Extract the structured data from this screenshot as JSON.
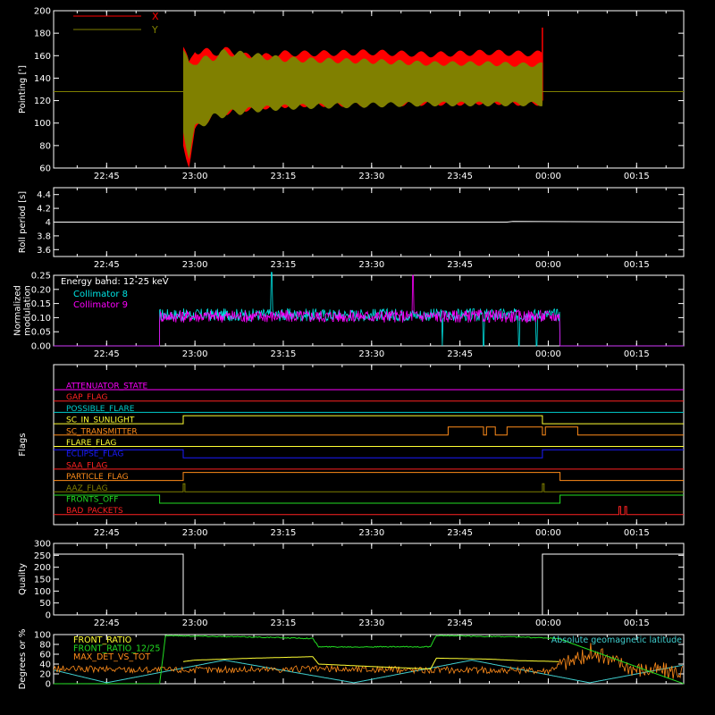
{
  "colors": {
    "background": "#000000",
    "axis": "#ffffff",
    "x_series": "#ff0000",
    "y_series": "#808000",
    "collimator8": "#00e5e5",
    "collimator9": "#ff00ff",
    "attenuator_state": "#ff00ff",
    "gap_flag": "#ff2222",
    "possible_flare": "#00cccc",
    "sc_in_sunlight": "#ffff33",
    "sc_transmitter": "#ff8c1a",
    "flare_flag": "#ffff33",
    "eclipse_flag": "#1b1bff",
    "saa_flag": "#ff2222",
    "particle_flag": "#ff8c1a",
    "aaz_flag": "#808000",
    "fronts_off": "#22dd22",
    "bad_packets": "#ff2222",
    "quality": "#ffffff",
    "front_ratio": "#ffff33",
    "front_ratio_1225": "#22dd22",
    "max_det_vs_tot": "#ff8c1a",
    "latitude": "#40d0d0"
  },
  "chart_data": [
    {
      "id": "pointing",
      "type": "line",
      "ylabel": "Pointing [']",
      "xlim": [
        "22:36",
        "00:23"
      ],
      "ylim": [
        60,
        200
      ],
      "x_ticks": [
        "22:45",
        "23:00",
        "23:15",
        "23:30",
        "23:45",
        "00:00",
        "00:15"
      ],
      "y_ticks": [
        60,
        80,
        100,
        120,
        140,
        160,
        180,
        200
      ],
      "legend_position": "top-left",
      "series": [
        {
          "name": "X",
          "color": "#ff0000",
          "constant_before": 128,
          "envelope_x": [
            "22:58",
            "22:59",
            "23:00",
            "23:03",
            "23:05",
            "23:10",
            "23:15",
            "23:20",
            "23:30",
            "23:40",
            "23:45",
            "23:50",
            "23:55",
            "23:59"
          ],
          "upper": [
            168,
            150,
            166,
            162,
            165,
            158,
            162,
            162,
            163,
            161,
            162,
            163,
            162,
            162
          ],
          "lower": [
            80,
            65,
            92,
            108,
            110,
            114,
            116,
            117,
            117,
            118,
            118,
            119,
            118,
            118
          ],
          "constant_after": 128,
          "spike": [
            "23:59",
            185
          ]
        },
        {
          "name": "Y",
          "color": "#808000",
          "constant_before": 128,
          "envelope_x": [
            "22:58",
            "22:59",
            "23:00",
            "23:03",
            "23:05",
            "23:10",
            "23:15",
            "23:20",
            "23:30",
            "23:40",
            "23:45",
            "23:50",
            "23:55",
            "23:59"
          ],
          "upper": [
            165,
            150,
            155,
            158,
            163,
            160,
            157,
            156,
            155,
            153,
            153,
            153,
            152,
            152
          ],
          "lower": [
            92,
            72,
            95,
            105,
            108,
            112,
            114,
            115,
            116,
            117,
            117,
            117,
            117,
            117
          ],
          "constant_after": 128
        }
      ]
    },
    {
      "id": "roll",
      "type": "line",
      "ylabel": "Roll period [s]",
      "xlim": [
        "22:36",
        "00:23"
      ],
      "ylim": [
        3.5,
        4.5
      ],
      "x_ticks": [
        "22:45",
        "23:00",
        "23:15",
        "23:30",
        "23:45",
        "00:00",
        "00:15"
      ],
      "y_ticks": [
        3.6,
        3.8,
        4.0,
        4.2,
        4.4
      ],
      "series": [
        {
          "name": "",
          "color": "#ffffff",
          "x": [
            "22:36",
            "23:53",
            "23:54",
            "00:23"
          ],
          "values": [
            4.0,
            4.0,
            4.01,
            4.0
          ]
        }
      ]
    },
    {
      "id": "modulation",
      "type": "line",
      "ylabel": "Normalized modulation",
      "xlim": [
        "22:36",
        "00:23"
      ],
      "ylim": [
        0,
        0.25
      ],
      "x_ticks": [
        "22:45",
        "23:00",
        "23:15",
        "23:30",
        "23:45",
        "00:00",
        "00:15"
      ],
      "y_ticks": [
        0.0,
        0.05,
        0.1,
        0.15,
        0.2,
        0.25
      ],
      "y_tick_labels": [
        "0.00",
        "0.05",
        "0.10",
        "0.15",
        "0.20",
        "0.25"
      ],
      "annotation": "Energy band: 12-25 keV",
      "active_range": [
        "22:54",
        "00:02"
      ],
      "series": [
        {
          "name": "Collimator 8",
          "color": "#00e5e5",
          "baseline": 0.11,
          "spikes": [
            [
              "23:13",
              0.26
            ],
            [
              "23:42",
              0.0
            ],
            [
              "23:49",
              0.0
            ],
            [
              "23:55",
              0.0
            ],
            [
              "23:58",
              0.0
            ]
          ]
        },
        {
          "name": "Collimator 9",
          "color": "#ff00ff",
          "baseline": 0.105,
          "spikes": [
            [
              "23:37",
              0.25
            ]
          ]
        }
      ]
    },
    {
      "id": "flags",
      "type": "line",
      "ylabel": "Flags",
      "xlim": [
        "22:36",
        "00:23"
      ],
      "x_ticks": [
        "22:45",
        "23:00",
        "23:15",
        "23:30",
        "23:45",
        "00:00",
        "00:15"
      ],
      "flags": [
        {
          "name": "ATTENUATOR_STATE",
          "color": "#ff00ff",
          "transitions": [
            [
              "22:36",
              0
            ]
          ]
        },
        {
          "name": "GAP_FLAG",
          "color": "#ff2222",
          "transitions": [
            [
              "22:36",
              0
            ]
          ]
        },
        {
          "name": "POSSIBLE_FLARE",
          "color": "#00cccc",
          "transitions": [
            [
              "22:36",
              0
            ]
          ]
        },
        {
          "name": "SC_IN_SUNLIGHT",
          "color": "#ffff33",
          "transitions": [
            [
              "22:36",
              0
            ],
            [
              "22:58",
              1
            ],
            [
              "23:59",
              0
            ]
          ]
        },
        {
          "name": "SC_TRANSMITTER",
          "color": "#ff8c1a",
          "transitions": [
            [
              "22:36",
              0
            ],
            [
              "23:43",
              1
            ],
            [
              "23:49",
              0
            ],
            [
              "23:49.5",
              1
            ],
            [
              "23:51",
              0
            ],
            [
              "23:53",
              1
            ],
            [
              "23:59",
              0
            ],
            [
              "23:59.5",
              1
            ],
            [
              "00:05",
              0
            ]
          ]
        },
        {
          "name": "FLARE_FLAG",
          "color": "#ffff33",
          "transitions": [
            [
              "22:36",
              0
            ]
          ]
        },
        {
          "name": "ECLIPSE_FLAG",
          "color": "#1b1bff",
          "transitions": [
            [
              "22:36",
              1
            ],
            [
              "22:58",
              0
            ],
            [
              "23:59",
              1
            ]
          ]
        },
        {
          "name": "SAA_FLAG",
          "color": "#ff2222",
          "transitions": [
            [
              "22:36",
              0
            ]
          ]
        },
        {
          "name": "PARTICLE_FLAG",
          "color": "#ff8c1a",
          "transitions": [
            [
              "22:36",
              0
            ],
            [
              "22:58",
              1
            ],
            [
              "00:02",
              0
            ]
          ]
        },
        {
          "name": "AAZ_FLAG",
          "color": "#808000",
          "transitions": [
            [
              "22:36",
              0
            ],
            [
              "22:58",
              1
            ],
            [
              "22:58.3",
              0
            ],
            [
              "23:59",
              1
            ],
            [
              "23:59.3",
              0
            ]
          ]
        },
        {
          "name": "FRONTS_OFF",
          "color": "#22dd22",
          "transitions": [
            [
              "22:36",
              1
            ],
            [
              "22:54",
              0
            ],
            [
              "00:02",
              1
            ]
          ]
        },
        {
          "name": "BAD_PACKETS",
          "color": "#ff2222",
          "transitions": [
            [
              "22:36",
              0
            ],
            [
              "00:12",
              1
            ],
            [
              "00:12.3",
              0
            ],
            [
              "00:13",
              1
            ],
            [
              "00:13.3",
              0
            ]
          ]
        }
      ]
    },
    {
      "id": "quality",
      "type": "line",
      "ylabel": "Quality",
      "xlim": [
        "22:36",
        "00:23"
      ],
      "ylim": [
        0,
        300
      ],
      "x_ticks": [
        "22:45",
        "23:00",
        "23:15",
        "23:30",
        "23:45",
        "00:00",
        "00:15"
      ],
      "y_ticks": [
        0,
        50,
        100,
        150,
        200,
        250,
        300
      ],
      "series": [
        {
          "name": "",
          "color": "#ffffff",
          "x": [
            "22:36",
            "22:58",
            "22:58",
            "23:59",
            "23:59",
            "00:23"
          ],
          "values": [
            255,
            255,
            0,
            0,
            255,
            255
          ]
        }
      ]
    },
    {
      "id": "ratios",
      "type": "line",
      "ylabel": "Degrees or %",
      "xlim": [
        "22:36",
        "00:23"
      ],
      "ylim": [
        0,
        100
      ],
      "x_ticks": [
        "22:45",
        "23:00",
        "23:15",
        "23:30",
        "23:45",
        "00:00",
        "00:15"
      ],
      "y_ticks": [
        0,
        20,
        40,
        60,
        80,
        100
      ],
      "series": [
        {
          "name": "FRONT_RATIO",
          "color": "#ffff33",
          "x": [
            "22:58",
            "23:00",
            "23:05",
            "23:10",
            "23:20",
            "23:21",
            "23:30",
            "23:40",
            "23:41",
            "23:50",
            "23:55",
            "00:02"
          ],
          "values": [
            45,
            48,
            50,
            52,
            55,
            40,
            35,
            30,
            52,
            50,
            47,
            45
          ]
        },
        {
          "name": "FRONT_RATIO_12/25",
          "color": "#22dd22",
          "x": [
            "22:54",
            "22:55",
            "23:10",
            "23:20",
            "23:21",
            "23:40",
            "23:41",
            "23:55",
            "00:02",
            "00:02"
          ],
          "values": [
            0,
            98,
            95,
            92,
            75,
            75,
            98,
            95,
            92,
            0
          ]
        },
        {
          "name": "MAX_DET_VS_TOT",
          "color": "#ff8c1a",
          "x": [
            "22:36",
            "23:00",
            "23:20",
            "23:40",
            "00:00",
            "00:02",
            "00:08",
            "00:15",
            "00:23"
          ],
          "values": [
            30,
            28,
            30,
            28,
            27,
            40,
            60,
            30,
            25
          ]
        },
        {
          "name": "Absolute geomagnetic latitude",
          "color": "#40d0d0",
          "x": [
            "22:36",
            "22:45",
            "23:05",
            "23:27",
            "23:47",
            "00:07",
            "00:23"
          ],
          "values": [
            28,
            2,
            48,
            2,
            48,
            2,
            38
          ]
        }
      ]
    }
  ]
}
